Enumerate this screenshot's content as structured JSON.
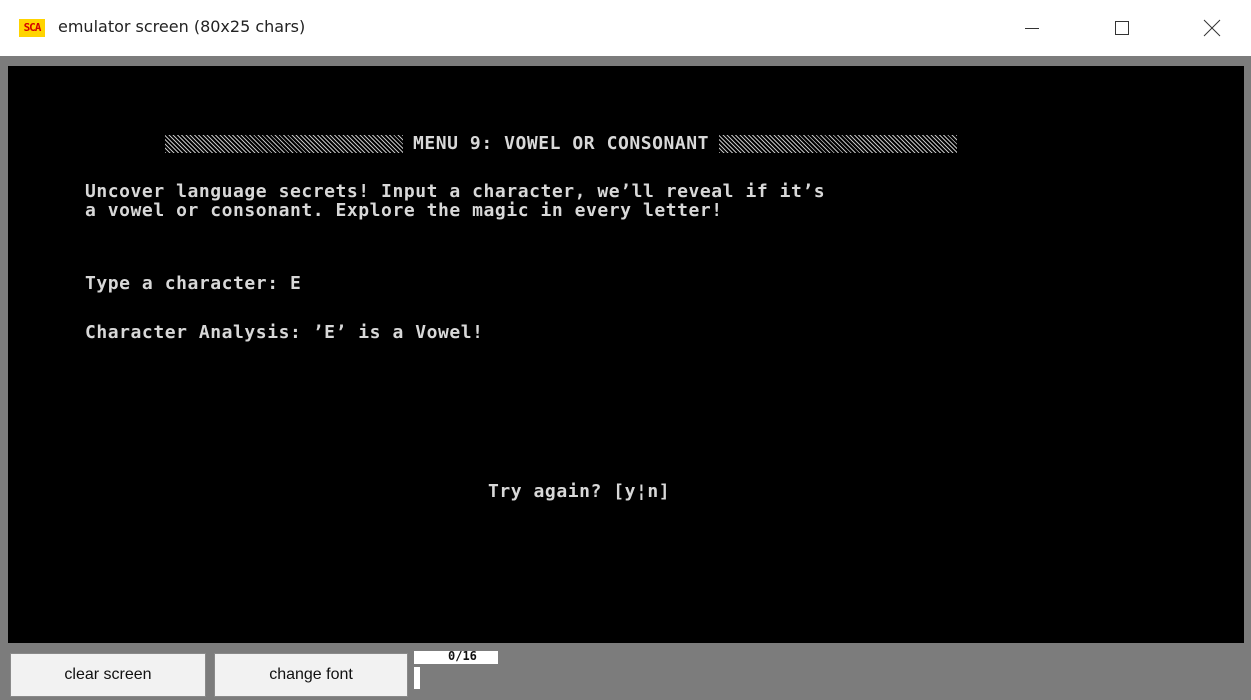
{
  "window": {
    "app_icon_text": "SCA",
    "title": "emulator screen (80x25 chars)",
    "controls": {
      "minimize": "minimize-icon",
      "maximize": "maximize-icon",
      "close": "close-icon"
    }
  },
  "terminal": {
    "menu_title": "MENU 9: VOWEL OR CONSONANT",
    "intro_line_1": "Uncover language secrets! Input a character, we’ll reveal if it’s",
    "intro_line_2": "a vowel or consonant. Explore the magic in every letter!",
    "prompt": "Type a character: E",
    "analysis": "Character Analysis: ’E’ is a Vowel!",
    "retry_prompt": "Try again? [y¦n]"
  },
  "bottom_bar": {
    "clear_label": "clear screen",
    "font_label": "change font",
    "counter": "0/16"
  },
  "colors": {
    "terminal_bg": "#000000",
    "terminal_fg": "#d8d8d8",
    "frame": "#7c7c7c",
    "icon_bg": "#ffd400",
    "icon_fg": "#d40000"
  }
}
